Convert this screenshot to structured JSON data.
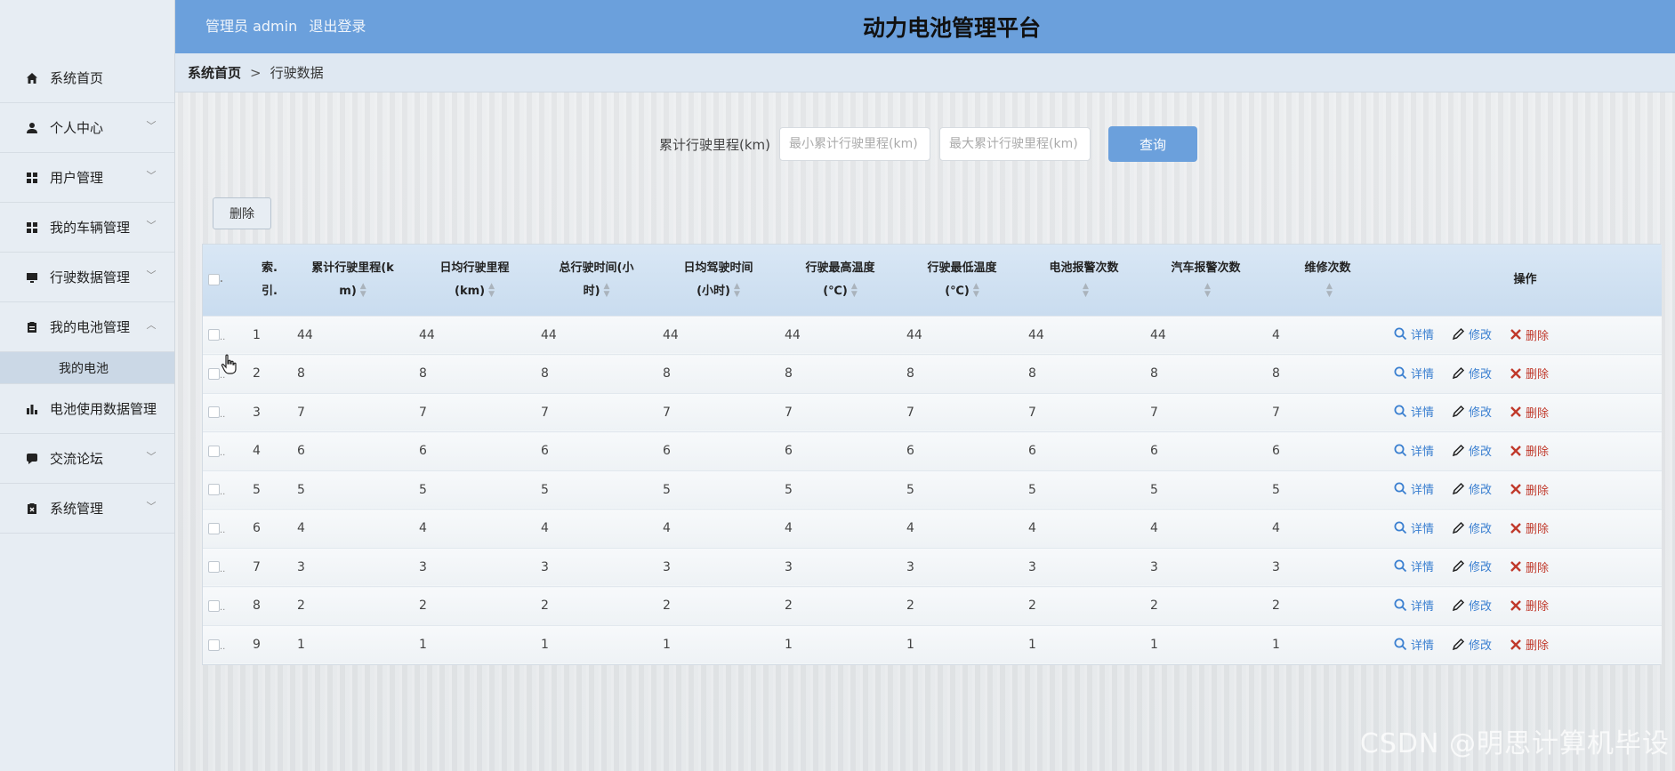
{
  "header": {
    "user_label": "管理员 admin",
    "logout": "退出登录",
    "title": "动力电池管理平台"
  },
  "breadcrumb": {
    "home": "系统首页",
    "sep": ">",
    "current": "行驶数据"
  },
  "sidebar": {
    "items": [
      {
        "label": "系统首页",
        "icon": "home-icon",
        "chevron": false
      },
      {
        "label": "个人中心",
        "icon": "user-icon",
        "chevron": true
      },
      {
        "label": "用户管理",
        "icon": "grid-icon",
        "chevron": true
      },
      {
        "label": "我的车辆管理",
        "icon": "grid-icon",
        "chevron": true
      },
      {
        "label": "行驶数据管理",
        "icon": "monitor-icon",
        "chevron": true
      },
      {
        "label": "我的电池管理",
        "icon": "clipboard-icon",
        "chevron": true,
        "expanded": true
      },
      {
        "label": "电池使用数据管理",
        "icon": "bar-chart-icon",
        "chevron": false
      },
      {
        "label": "交流论坛",
        "icon": "chat-icon",
        "chevron": true
      },
      {
        "label": "系统管理",
        "icon": "clipboard-x-icon",
        "chevron": true
      }
    ],
    "submenu": {
      "label": "我的电池"
    }
  },
  "search": {
    "label": "累计行驶里程(km)",
    "min_placeholder": "最小累计行驶里程(km)",
    "max_placeholder": "最大累计行驶里程(km)",
    "button": "查询"
  },
  "batch_delete": "删除",
  "table": {
    "headers": [
      {
        "l1": "索.",
        "l2": "引."
      },
      {
        "l1": "累计行驶里程(k",
        "l2": "m)"
      },
      {
        "l1": "日均行驶里程",
        "l2": "(km)"
      },
      {
        "l1": "总行驶时间(小",
        "l2": "时)"
      },
      {
        "l1": "日均驾驶时间",
        "l2": "(小时)"
      },
      {
        "l1": "行驶最高温度",
        "l2": "(℃)"
      },
      {
        "l1": "行驶最低温度",
        "l2": "(℃)"
      },
      {
        "l1": "电池报警次数",
        "l2": ""
      },
      {
        "l1": "汽车报警次数",
        "l2": ""
      },
      {
        "l1": "维修次数",
        "l2": ""
      },
      {
        "l1": "操作",
        "l2": ""
      }
    ],
    "rows": [
      [
        "1",
        "44",
        "44",
        "44",
        "44",
        "44",
        "44",
        "44",
        "44",
        "4"
      ],
      [
        "2",
        "8",
        "8",
        "8",
        "8",
        "8",
        "8",
        "8",
        "8",
        "8"
      ],
      [
        "3",
        "7",
        "7",
        "7",
        "7",
        "7",
        "7",
        "7",
        "7",
        "7"
      ],
      [
        "4",
        "6",
        "6",
        "6",
        "6",
        "6",
        "6",
        "6",
        "6",
        "6"
      ],
      [
        "5",
        "5",
        "5",
        "5",
        "5",
        "5",
        "5",
        "5",
        "5",
        "5"
      ],
      [
        "6",
        "4",
        "4",
        "4",
        "4",
        "4",
        "4",
        "4",
        "4",
        "4"
      ],
      [
        "7",
        "3",
        "3",
        "3",
        "3",
        "3",
        "3",
        "3",
        "3",
        "3"
      ],
      [
        "8",
        "2",
        "2",
        "2",
        "2",
        "2",
        "2",
        "2",
        "2",
        "2"
      ],
      [
        "9",
        "1",
        "1",
        "1",
        "1",
        "1",
        "1",
        "1",
        "1",
        "1"
      ]
    ],
    "actions": {
      "detail": "详情",
      "edit": "修改",
      "delete": "删除"
    },
    "checkbox_suffix": "..",
    "header_checkbox_suffix": "."
  },
  "watermark": "CSDN @明思计算机毕设"
}
